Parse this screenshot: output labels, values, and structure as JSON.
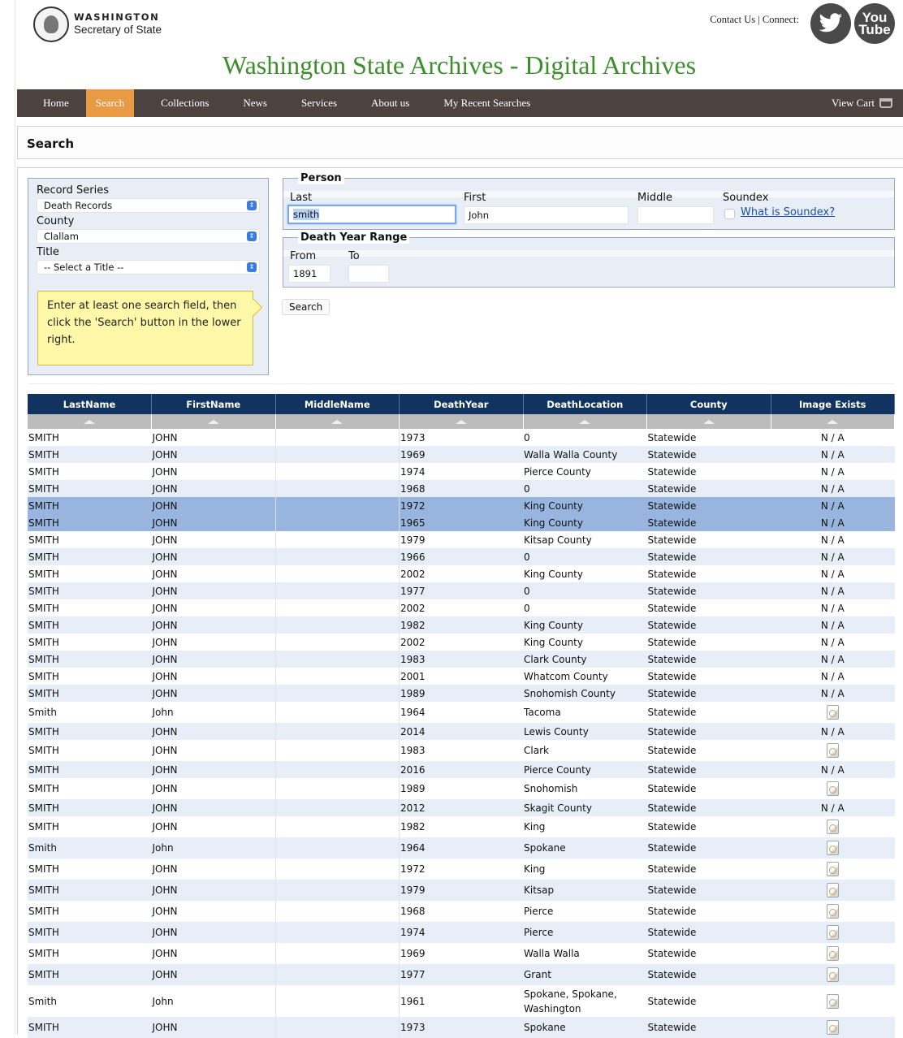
{
  "header": {
    "logo_title": "WASHINGTON",
    "logo_subtitle": "Secretary of State",
    "contact": "Contact Us",
    "connect": "| Connect:",
    "youtube_line1": "You",
    "youtube_line2": "Tube",
    "site_title": "Washington State Archives - Digital Archives"
  },
  "nav": {
    "items": [
      "Home",
      "Search",
      "Collections",
      "News",
      "Services",
      "About us",
      "My Recent Searches"
    ],
    "active": "Search",
    "cart": "View Cart"
  },
  "search_header": "Search",
  "filters": {
    "record_series_label": "Record Series",
    "record_series_value": "Death Records",
    "county_label": "County",
    "county_value": "Clallam",
    "title_label": "Title",
    "title_value": "-- Select a Title --",
    "tip": "Enter at least one search field, then click the 'Search' button in the lower right."
  },
  "person": {
    "legend": "Person",
    "last_label": "Last",
    "last_value": "smith",
    "first_label": "First",
    "first_value": "John",
    "middle_label": "Middle",
    "middle_value": "",
    "soundex_label": "Soundex",
    "soundex_link": "What is Soundex?"
  },
  "year_range": {
    "legend": "Death Year Range",
    "from_label": "From",
    "from_value": "1891",
    "to_label": "To",
    "to_value": ""
  },
  "search_button": "Search",
  "table": {
    "columns": [
      "LastName",
      "FirstName",
      "MiddleName",
      "DeathYear",
      "DeathLocation",
      "County",
      "Image Exists"
    ],
    "rows": [
      {
        "last": "SMITH",
        "first": "JOHN",
        "middle": "",
        "year": "1973",
        "location": "0",
        "county": "Statewide",
        "image": "N / A"
      },
      {
        "last": "SMITH",
        "first": "JOHN",
        "middle": "",
        "year": "1969",
        "location": "Walla Walla County",
        "county": "Statewide",
        "image": "N / A"
      },
      {
        "last": "SMITH",
        "first": "JOHN",
        "middle": "",
        "year": "1974",
        "location": "Pierce County",
        "county": "Statewide",
        "image": "N / A"
      },
      {
        "last": "SMITH",
        "first": "JOHN",
        "middle": "",
        "year": "1968",
        "location": "0",
        "county": "Statewide",
        "image": "N / A"
      },
      {
        "last": "SMITH",
        "first": "JOHN",
        "middle": "",
        "year": "1972",
        "location": "King County",
        "county": "Statewide",
        "image": "N / A",
        "selected": true
      },
      {
        "last": "SMITH",
        "first": "JOHN",
        "middle": "",
        "year": "1965",
        "location": "King County",
        "county": "Statewide",
        "image": "N / A",
        "selected": true
      },
      {
        "last": "SMITH",
        "first": "JOHN",
        "middle": "",
        "year": "1979",
        "location": "Kitsap County",
        "county": "Statewide",
        "image": "N / A"
      },
      {
        "last": "SMITH",
        "first": "JOHN",
        "middle": "",
        "year": "1966",
        "location": "0",
        "county": "Statewide",
        "image": "N / A"
      },
      {
        "last": "SMITH",
        "first": "JOHN",
        "middle": "",
        "year": "2002",
        "location": "King County",
        "county": "Statewide",
        "image": "N / A"
      },
      {
        "last": "SMITH",
        "first": "JOHN",
        "middle": "",
        "year": "1977",
        "location": "0",
        "county": "Statewide",
        "image": "N / A"
      },
      {
        "last": "SMITH",
        "first": "JOHN",
        "middle": "",
        "year": "2002",
        "location": "0",
        "county": "Statewide",
        "image": "N / A"
      },
      {
        "last": "SMITH",
        "first": "JOHN",
        "middle": "",
        "year": "1982",
        "location": "King County",
        "county": "Statewide",
        "image": "N / A"
      },
      {
        "last": "SMITH",
        "first": "JOHN",
        "middle": "",
        "year": "2002",
        "location": "King County",
        "county": "Statewide",
        "image": "N / A"
      },
      {
        "last": "SMITH",
        "first": "JOHN",
        "middle": "",
        "year": "1983",
        "location": "Clark County",
        "county": "Statewide",
        "image": "N / A"
      },
      {
        "last": "SMITH",
        "first": "JOHN",
        "middle": "",
        "year": "2001",
        "location": "Whatcom County",
        "county": "Statewide",
        "image": "N / A"
      },
      {
        "last": "SMITH",
        "first": "JOHN",
        "middle": "",
        "year": "1989",
        "location": "Snohomish County",
        "county": "Statewide",
        "image": "N / A"
      },
      {
        "last": "Smith",
        "first": "John",
        "middle": "",
        "year": "1964",
        "location": "Tacoma",
        "county": "Statewide",
        "image": "icon"
      },
      {
        "last": "SMITH",
        "first": "JOHN",
        "middle": "",
        "year": "2014",
        "location": "Lewis County",
        "county": "Statewide",
        "image": "N / A"
      },
      {
        "last": "SMITH",
        "first": "JOHN",
        "middle": "",
        "year": "1983",
        "location": "Clark",
        "county": "Statewide",
        "image": "icon"
      },
      {
        "last": "SMITH",
        "first": "JOHN",
        "middle": "",
        "year": "2016",
        "location": "Pierce County",
        "county": "Statewide",
        "image": "N / A"
      },
      {
        "last": "SMITH",
        "first": "JOHN",
        "middle": "",
        "year": "1989",
        "location": "Snohomish",
        "county": "Statewide",
        "image": "icon"
      },
      {
        "last": "SMITH",
        "first": "JOHN",
        "middle": "",
        "year": "2012",
        "location": "Skagit County",
        "county": "Statewide",
        "image": "N / A"
      },
      {
        "last": "SMITH",
        "first": "JOHN",
        "middle": "",
        "year": "1982",
        "location": "King",
        "county": "Statewide",
        "image": "icon"
      },
      {
        "last": "Smith",
        "first": "John",
        "middle": "",
        "year": "1964",
        "location": "Spokane",
        "county": "Statewide",
        "image": "icon"
      },
      {
        "last": "SMITH",
        "first": "JOHN",
        "middle": "",
        "year": "1972",
        "location": "King",
        "county": "Statewide",
        "image": "icon"
      },
      {
        "last": "SMITH",
        "first": "JOHN",
        "middle": "",
        "year": "1979",
        "location": "Kitsap",
        "county": "Statewide",
        "image": "icon"
      },
      {
        "last": "SMITH",
        "first": "JOHN",
        "middle": "",
        "year": "1968",
        "location": "Pierce",
        "county": "Statewide",
        "image": "icon"
      },
      {
        "last": "SMITH",
        "first": "JOHN",
        "middle": "",
        "year": "1974",
        "location": "Pierce",
        "county": "Statewide",
        "image": "icon"
      },
      {
        "last": "SMITH",
        "first": "JOHN",
        "middle": "",
        "year": "1969",
        "location": "Walla Walla",
        "county": "Statewide",
        "image": "icon"
      },
      {
        "last": "SMITH",
        "first": "JOHN",
        "middle": "",
        "year": "1977",
        "location": "Grant",
        "county": "Statewide",
        "image": "icon"
      },
      {
        "last": "Smith",
        "first": "John",
        "middle": "",
        "year": "1961",
        "location": "Spokane, Spokane, Washington",
        "county": "Statewide",
        "image": "icon"
      },
      {
        "last": "SMITH",
        "first": "JOHN",
        "middle": "",
        "year": "1973",
        "location": "Spokane",
        "county": "Statewide",
        "image": "icon"
      }
    ]
  }
}
